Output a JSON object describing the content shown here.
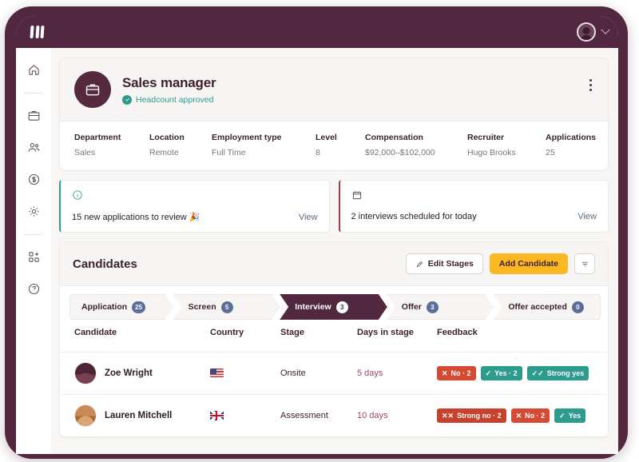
{
  "topbar": {
    "logo_name": "three-wave-logo",
    "avatar_name": "user-avatar",
    "chevron_label": "account-menu"
  },
  "sidebar": {
    "items": [
      {
        "icon": "home-icon",
        "name": "sidebar-item-home"
      },
      {
        "icon": "briefcase-icon",
        "name": "sidebar-item-jobs"
      },
      {
        "icon": "people-icon",
        "name": "sidebar-item-people"
      },
      {
        "icon": "dollar-icon",
        "name": "sidebar-item-compensation"
      },
      {
        "icon": "gear-icon",
        "name": "sidebar-item-settings"
      },
      {
        "icon": "add-apps-icon",
        "name": "sidebar-item-apps"
      },
      {
        "icon": "help-icon",
        "name": "sidebar-item-help"
      }
    ]
  },
  "job": {
    "title": "Sales manager",
    "status": "Headcount approved",
    "avatar_icon": "briefcase-icon",
    "menu_icon": "kebab-menu-icon",
    "meta": [
      {
        "key": "Department",
        "value": "Sales"
      },
      {
        "key": "Location",
        "value": "Remote"
      },
      {
        "key": "Employment type",
        "value": "Full Time"
      },
      {
        "key": "Level",
        "value": "8"
      },
      {
        "key": "Compensation",
        "value": "$92,000–$102,000"
      },
      {
        "key": "Recruiter",
        "value": "Hugo Brooks"
      },
      {
        "key": "Applications",
        "value": "25"
      }
    ]
  },
  "banners": [
    {
      "icon": "info-icon",
      "text": "15 new applications to review 🎉",
      "link": "View"
    },
    {
      "icon": "calendar-icon",
      "text": "2 interviews scheduled for today",
      "link": "View"
    }
  ],
  "candidates_section": {
    "title": "Candidates",
    "edit_stages_label": "Edit Stages",
    "edit_stages_icon": "pencil-icon",
    "add_candidate_label": "Add Candidate",
    "filter_icon": "filter-icon"
  },
  "pipeline": {
    "stages": [
      {
        "label": "Application",
        "count": "25",
        "active": false
      },
      {
        "label": "Screen",
        "count": "5",
        "active": false
      },
      {
        "label": "Interview",
        "count": "3",
        "active": true
      },
      {
        "label": "Offer",
        "count": "3",
        "active": false
      },
      {
        "label": "Offer accepted",
        "count": "0",
        "active": false
      }
    ]
  },
  "table": {
    "columns": [
      "Candidate",
      "Country",
      "Stage",
      "Days in stage",
      "Feedback"
    ],
    "rows": [
      {
        "name": "Zoe Wright",
        "avatar": "zoe",
        "country": "us",
        "country_name": "united-states-flag",
        "stage": "Onsite",
        "days": "5 days",
        "feedback": [
          {
            "label": "No · 2",
            "kind": "no",
            "glyph": "✕"
          },
          {
            "label": "Yes · 2",
            "kind": "yes",
            "glyph": "✓"
          },
          {
            "label": "Strong yes",
            "kind": "strongyes",
            "glyph": "✓✓"
          }
        ]
      },
      {
        "name": "Lauren Mitchell",
        "avatar": "lauren",
        "country": "uk",
        "country_name": "united-kingdom-flag",
        "stage": "Assessment",
        "days": "10 days",
        "feedback": [
          {
            "label": "Strong no · 2",
            "kind": "strongno",
            "glyph": "✕✕"
          },
          {
            "label": "No · 2",
            "kind": "no",
            "glyph": "✕"
          },
          {
            "label": "Yes",
            "kind": "yes",
            "glyph": "✓"
          }
        ]
      }
    ]
  },
  "colors": {
    "brand_maroon": "#522840",
    "accent_yellow": "#fcb823",
    "teal": "#2e9b8f",
    "red": "#d44a33",
    "badge_blue": "#5b6e99"
  }
}
